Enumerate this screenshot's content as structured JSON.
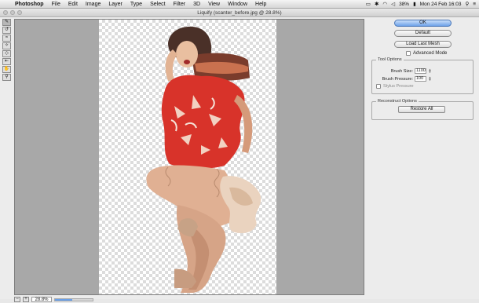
{
  "menubar": {
    "apple": "",
    "app": "Photoshop",
    "items": [
      "File",
      "Edit",
      "Image",
      "Layer",
      "Type",
      "Select",
      "Filter",
      "3D",
      "View",
      "Window",
      "Help"
    ],
    "battery": "38%",
    "clock": "Mon 24 Feb  16:03"
  },
  "window": {
    "title": "Liquify (scanter_before.jpg @ 28.8%)"
  },
  "tools": [
    "forward-warp",
    "reconstruct",
    "smooth",
    "pucker",
    "bloat",
    "push-left",
    "hand",
    "zoom"
  ],
  "status": {
    "zoom": "28.8%",
    "progress": 0.45
  },
  "panel": {
    "ok": "OK",
    "default": "Default",
    "load_last_mesh": "Load Last Mesh",
    "advanced_mode": "Advanced Mode",
    "tool_options": {
      "title": "Tool Options",
      "brush_size_label": "Brush Size:",
      "brush_size_value": "1100",
      "brush_pressure_label": "Brush Pressure:",
      "brush_pressure_value": "100",
      "stylus_pressure": "Stylus Pressure"
    },
    "reconstruct_options": {
      "title": "Reconstruct Options",
      "restore_all": "Restore All"
    }
  },
  "colors": {
    "accent": "#6ea2e8",
    "dress": "#d8332a",
    "skin": "#e3b596",
    "hair": "#4a3028"
  }
}
